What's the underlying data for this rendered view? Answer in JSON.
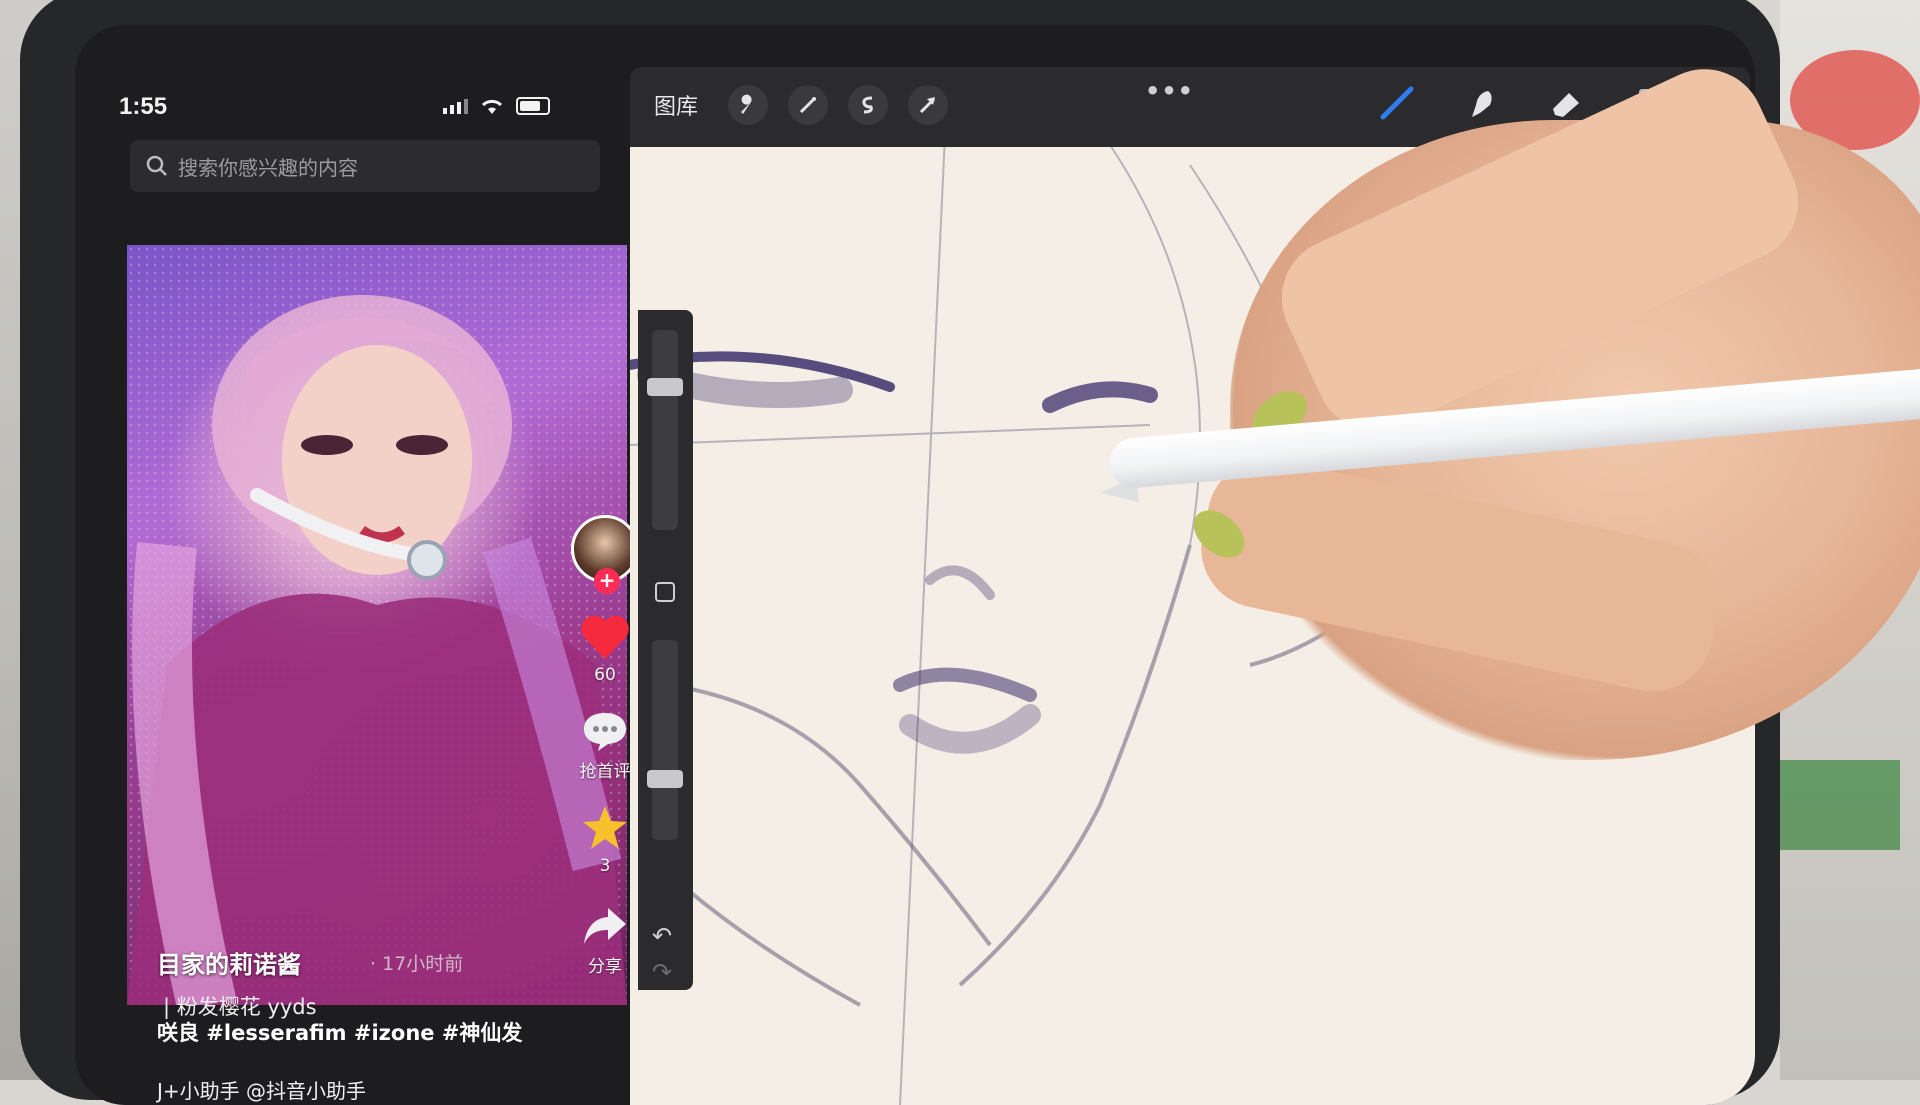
{
  "status_bar": {
    "time": "1:55"
  },
  "video_app": {
    "search": {
      "placeholder": "搜索你感兴趣的内容"
    },
    "actions": {
      "likes": "60",
      "comment_label": "抢首评",
      "favorites": "3",
      "share_label": "分享"
    },
    "video_meta": {
      "author": "目家的莉诺酱",
      "time_ago": "· 17小时前",
      "desc_line1": "| 粉发樱花 yyds",
      "desc_line2": "咲良 #lesserafim #izone #神仙发",
      "bottom_tag": "J+小助手 @抖音小助手"
    }
  },
  "drawing_app": {
    "toolbar": {
      "gallery_label": "图库",
      "buttons": [
        "wrench-icon",
        "magic-wand-icon",
        "selection-icon",
        "transform-arrow-icon"
      ],
      "more": "•••",
      "tools": [
        "brush-icon",
        "smudge-icon",
        "eraser-icon",
        "layers-icon"
      ],
      "active_color": "#231e64"
    },
    "canvas_color": "#f4eee6",
    "sketch_colors": {
      "ink": "#3b2f6b",
      "pencil": "#9d9aa6"
    }
  },
  "colors": {
    "like_red": "#f52a3c",
    "favorite_yellow": "#f6c12b",
    "follow_pink": "#fe2c55"
  }
}
